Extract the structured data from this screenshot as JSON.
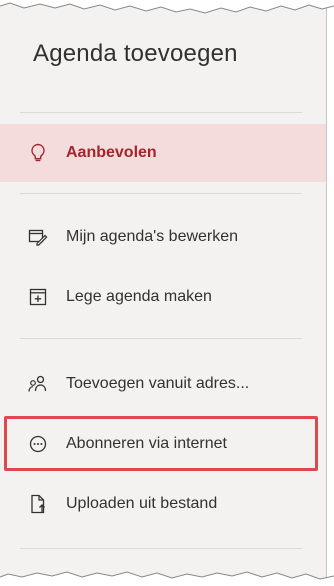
{
  "panel": {
    "title": "Agenda toevoegen"
  },
  "menu": {
    "items": [
      {
        "label": "Aanbevolen",
        "icon": "lightbulb-icon",
        "selected": true
      },
      {
        "label": "Mijn agenda's bewerken",
        "icon": "edit-calendar-icon"
      },
      {
        "label": "Lege agenda maken",
        "icon": "add-calendar-icon"
      },
      {
        "label": "Toevoegen vanuit adres...",
        "icon": "people-icon"
      },
      {
        "label": "Abonneren via internet",
        "icon": "more-circle-icon",
        "highlighted": true
      },
      {
        "label": "Uploaden uit bestand",
        "icon": "upload-file-icon"
      }
    ]
  },
  "colors": {
    "selected_text": "#a4262c",
    "selected_bg": "#f4dcdc",
    "highlight_border": "#e0474f"
  }
}
